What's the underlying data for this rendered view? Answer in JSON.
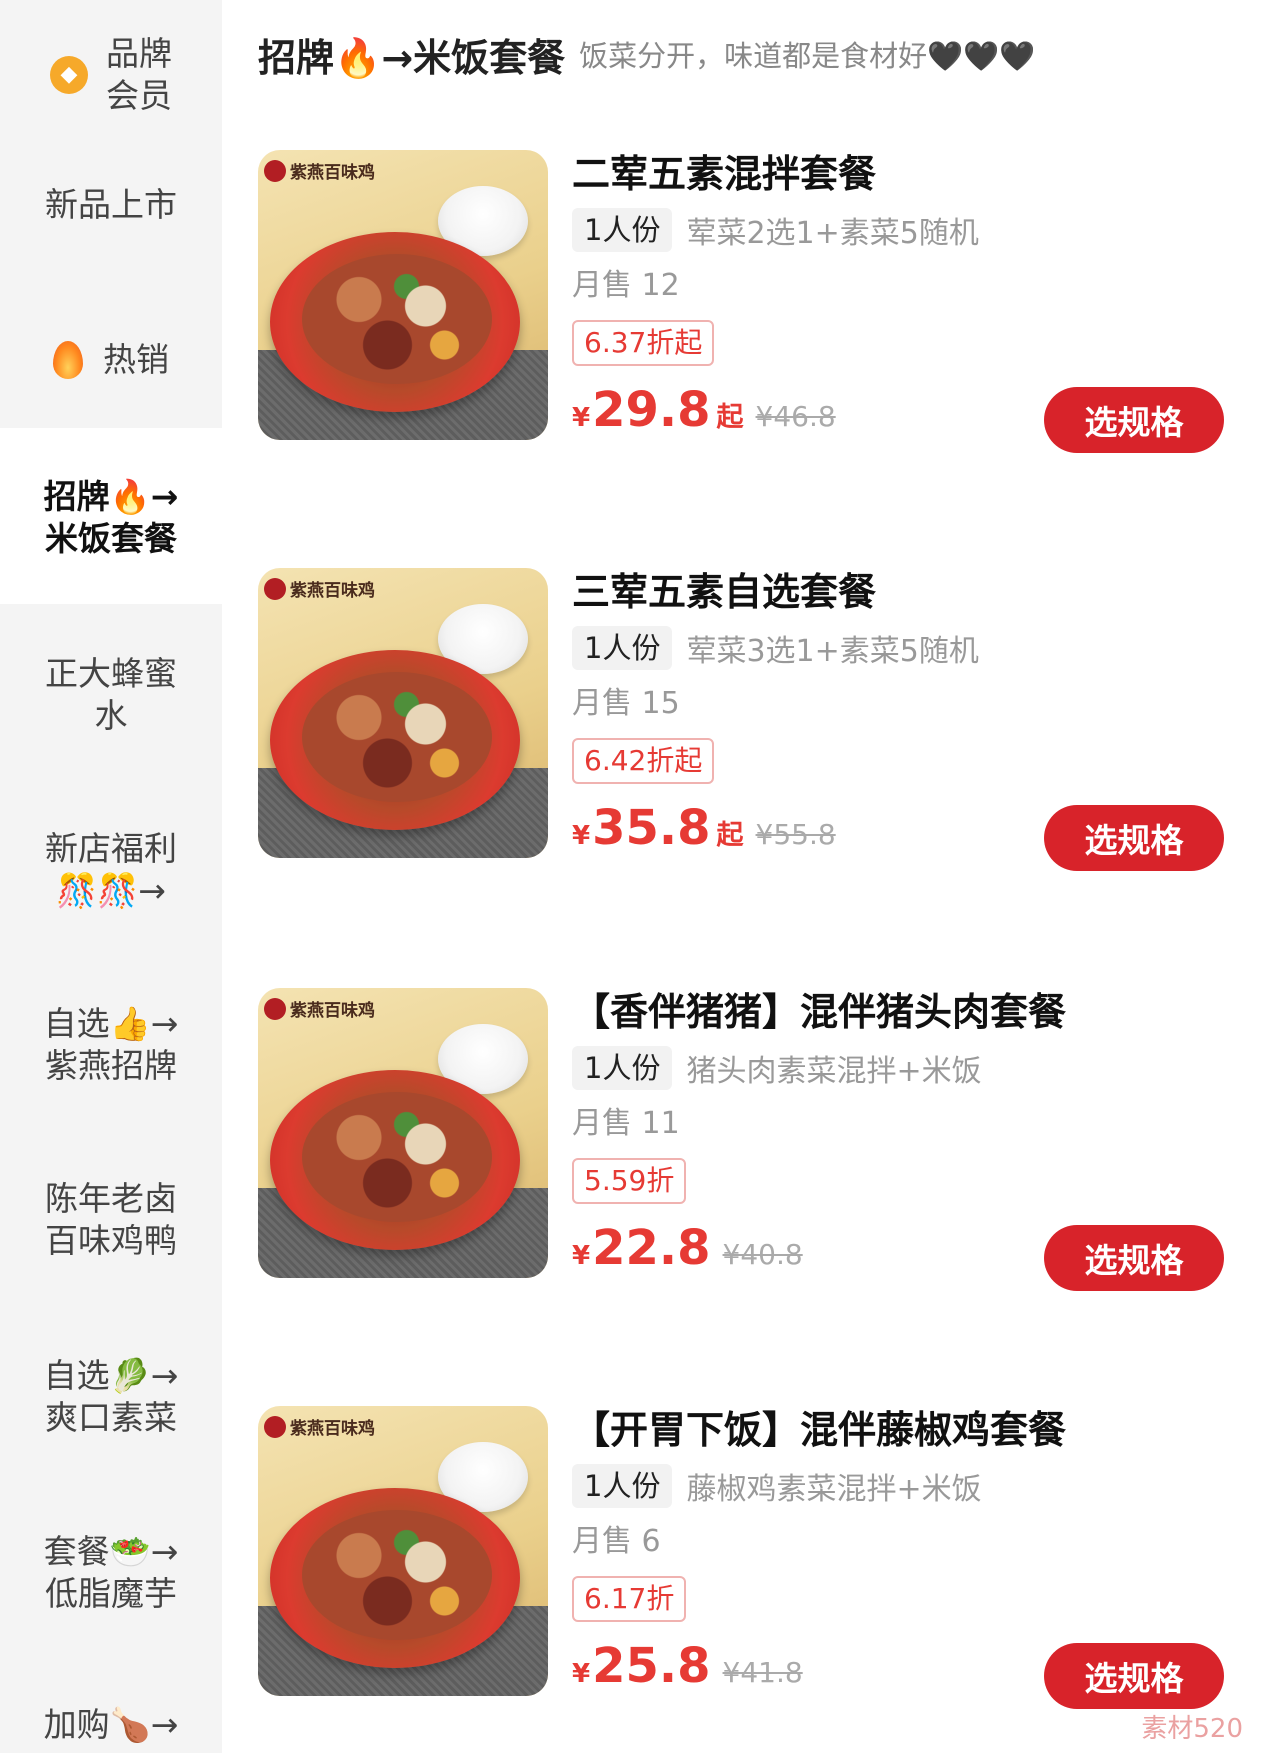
{
  "sidebar": {
    "items": [
      {
        "lines": [
          "品牌",
          "会员"
        ],
        "icon": "diamond-icon"
      },
      {
        "lines": [
          "新品上市"
        ]
      },
      {
        "lines": [
          "热销"
        ],
        "icon": "flame-icon"
      },
      {
        "lines": [
          "招牌🔥→",
          "米饭套餐"
        ],
        "active": true
      },
      {
        "lines": [
          "正大蜂蜜",
          "水"
        ]
      },
      {
        "lines": [
          "新店福利",
          "🎊🎊→"
        ]
      },
      {
        "lines": [
          "自选👍→",
          "紫燕招牌"
        ]
      },
      {
        "lines": [
          "陈年老卤",
          "百味鸡鸭"
        ]
      },
      {
        "lines": [
          "自选🥬→",
          "爽口素菜"
        ]
      },
      {
        "lines": [
          "套餐🥗→",
          "低脂魔芋"
        ]
      },
      {
        "lines": [
          "加购🍗→"
        ]
      }
    ]
  },
  "header": {
    "title": "招牌🔥→米饭套餐",
    "subtitle": "饭菜分开，味道都是食材好🖤🖤🖤"
  },
  "products": [
    {
      "title": "二荤五素混拌套餐",
      "spec": "1人份",
      "spec_desc": "荤菜2选1+素菜5随机",
      "sales": "月售 12",
      "discount": "6.37折起",
      "currency": "¥",
      "price": "29.8",
      "price_suffix": "起",
      "original_price": "¥46.8",
      "button": "选规格",
      "image_brand": "紫燕百味鸡"
    },
    {
      "title": "三荤五素自选套餐",
      "spec": "1人份",
      "spec_desc": "荤菜3选1+素菜5随机",
      "sales": "月售 15",
      "discount": "6.42折起",
      "currency": "¥",
      "price": "35.8",
      "price_suffix": "起",
      "original_price": "¥55.8",
      "button": "选规格",
      "image_brand": "紫燕百味鸡"
    },
    {
      "title": "【香伴猪猪】混伴猪头肉套餐",
      "spec": "1人份",
      "spec_desc": "猪头肉素菜混拌+米饭",
      "sales": "月售 11",
      "discount": "5.59折",
      "currency": "¥",
      "price": "22.8",
      "price_suffix": "",
      "original_price": "¥40.8",
      "button": "选规格",
      "image_brand": "紫燕百味鸡"
    },
    {
      "title": "【开胃下饭】混伴藤椒鸡套餐",
      "spec": "1人份",
      "spec_desc": "藤椒鸡素菜混拌+米饭",
      "sales": "月售 6",
      "discount": "6.17折",
      "currency": "¥",
      "price": "25.8",
      "price_suffix": "",
      "original_price": "¥41.8",
      "button": "选规格",
      "image_brand": "紫燕百味鸡"
    }
  ],
  "watermark": "素材520",
  "colors": {
    "accent": "#d8232a",
    "price": "#e63a34",
    "sidebar_bg": "#f4f4f4"
  }
}
